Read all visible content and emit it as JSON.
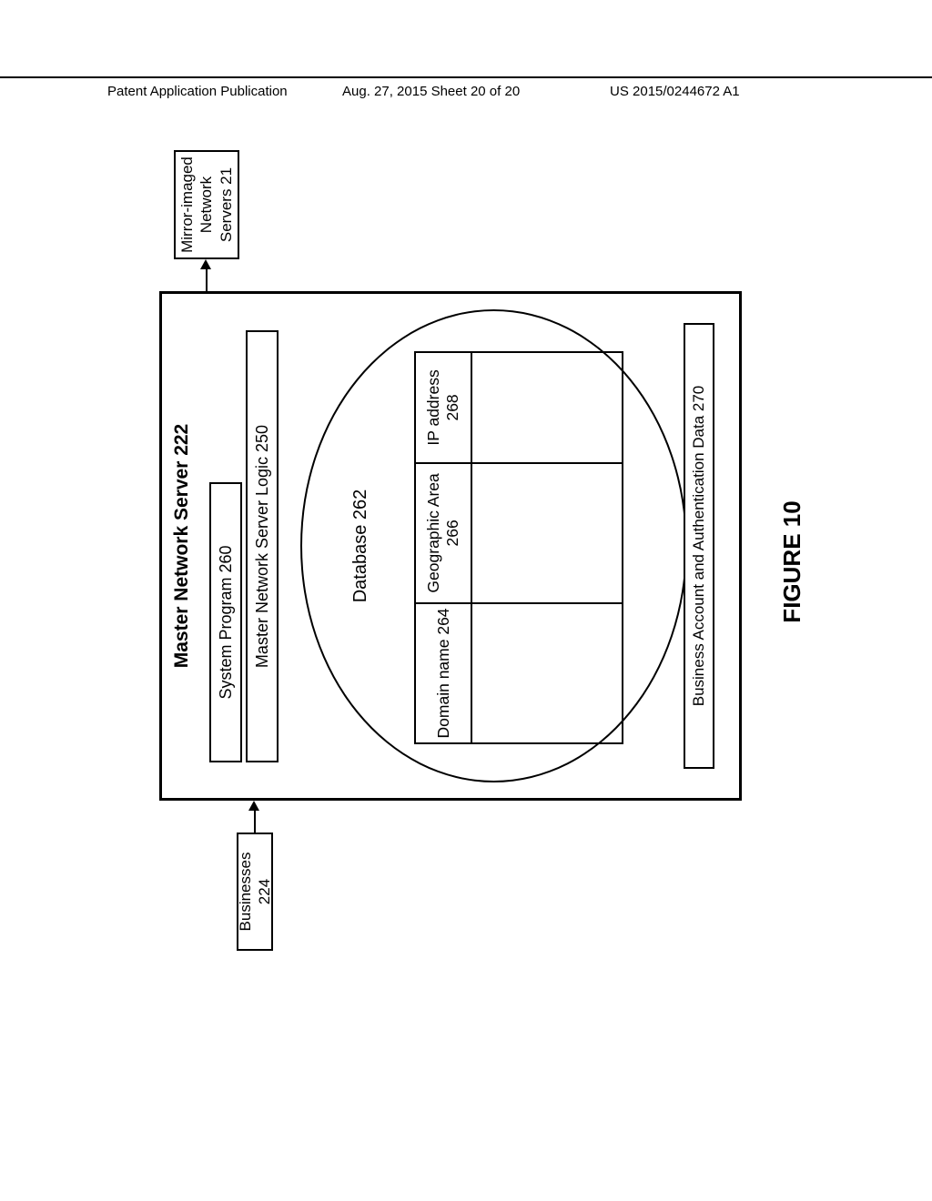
{
  "header": {
    "left": "Patent Application Publication",
    "center": "Aug. 27, 2015  Sheet 20 of 20",
    "right": "US 2015/0244672 A1"
  },
  "figure_label": "FIGURE 10",
  "master": {
    "title": "Master Network Server 222",
    "system_program": "System Program  260",
    "logic": "Master Network Server Logic  250",
    "database_label": "Database 262",
    "table": {
      "col1": "Domain name 264",
      "col2": "Geographic Area 266",
      "col3": "IP address 268"
    },
    "auth": "Business Account and Authentication Data  270"
  },
  "external": {
    "businesses": "Businesses 224",
    "mirror": "Mirror-imaged Network Servers 21"
  }
}
